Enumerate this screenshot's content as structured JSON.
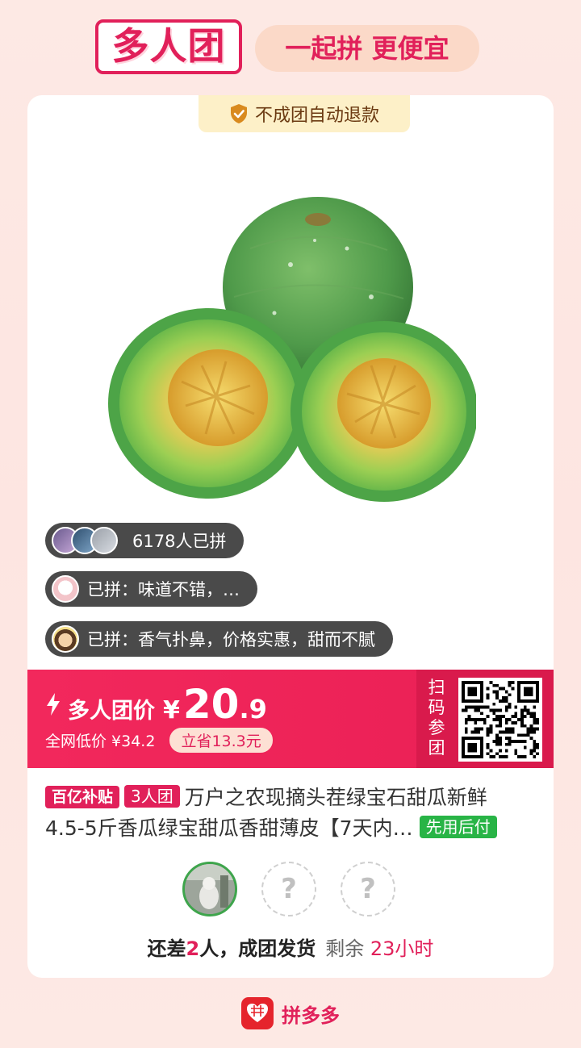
{
  "header": {
    "logo_text": "多人团",
    "slogan": "一起拼 更便宜"
  },
  "card": {
    "refund_badge": "不成团自动退款",
    "social": {
      "count_text": "6178人已拼",
      "review_1": "已拼：味道不错，…",
      "review_2": "已拼：香气扑鼻，价格实惠，甜而不腻"
    },
    "price": {
      "label": "多人团价",
      "currency": "¥",
      "integer": "20",
      "decimal": ".9",
      "market_price": "全网低价 ¥34.2",
      "save": "立省13.3元",
      "scan_label": "扫码参团"
    },
    "title": {
      "subsidy_tag": "百亿补贴",
      "group_tag": "3人团",
      "line1": "万户之农现摘头茬绿宝石甜瓜新鲜",
      "line2": "4.5-5斤香瓜绿宝甜瓜香甜薄皮【7天内…",
      "pay_later_tag": "先用后付"
    },
    "slots": {
      "empty_mark": "?"
    },
    "status": {
      "prefix": "还差",
      "count": "2",
      "suffix": "人，成团发货",
      "remaining": "剩余",
      "time": "23小时"
    }
  },
  "footer": {
    "brand": "拼多多"
  },
  "colors": {
    "brand_pink": "#e1205a",
    "banner_red": "#f2285c",
    "green_tag": "#28b446",
    "pill_bg": "#4a4a4a"
  },
  "icons": [
    "shield-check-icon",
    "lightning-icon",
    "qr-code",
    "question-icon",
    "pinduoduo-logo-icon"
  ]
}
